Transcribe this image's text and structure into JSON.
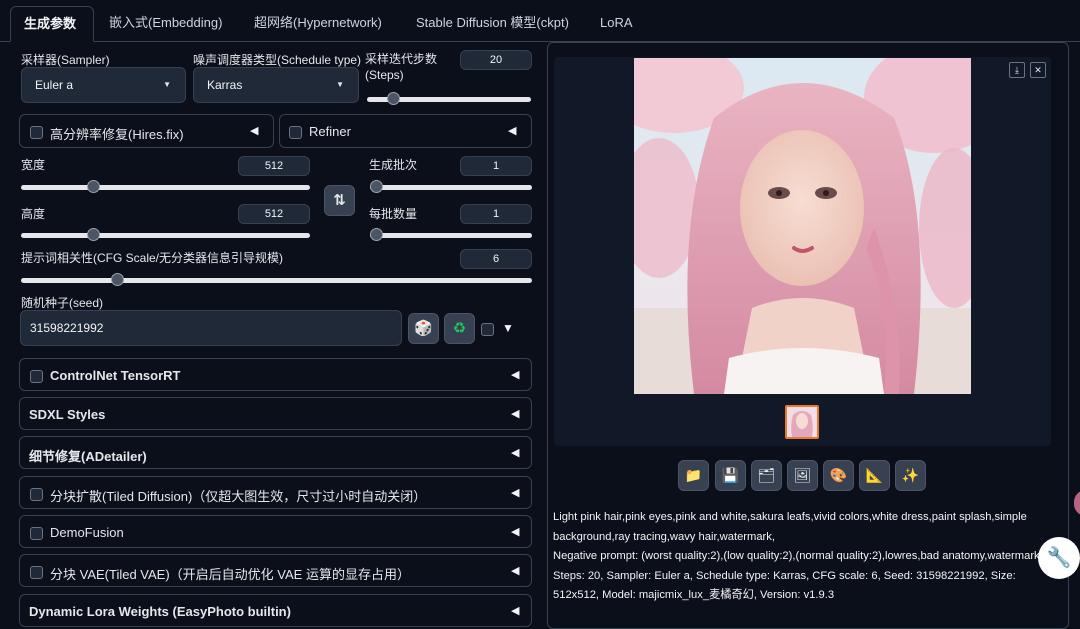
{
  "tabs": [
    "生成参数",
    "嵌入式(Embedding)",
    "超网络(Hypernetwork)",
    "Stable Diffusion 模型(ckpt)",
    "LoRA"
  ],
  "sampler": {
    "label": "采样器(Sampler)",
    "value": "Euler a"
  },
  "schedule": {
    "label": "噪声调度器类型(Schedule type)",
    "value": "Karras"
  },
  "steps": {
    "label_line1": "采样迭代步数",
    "label_line2": "(Steps)",
    "value": "20",
    "fraction": 0.13
  },
  "hires": {
    "label": "高分辨率修复(Hires.fix)",
    "collapse_glyph": "◀"
  },
  "refiner": {
    "label": "Refiner",
    "collapse_glyph": "◀"
  },
  "width": {
    "label": "宽度",
    "value": "512",
    "fraction": 0.24
  },
  "height": {
    "label": "高度",
    "value": "512",
    "fraction": 0.24
  },
  "swap_button": {
    "icon": "swap-icon",
    "glyph": "⇅"
  },
  "batch_count": {
    "label": "生成批次",
    "value": "1",
    "fraction": 0.0
  },
  "batch_size": {
    "label": "每批数量",
    "value": "1",
    "fraction": 0.0
  },
  "cfg": {
    "label": "提示词相关性(CFG Scale/无分类器信息引导规模)",
    "value": "6",
    "fraction": 0.18
  },
  "seed": {
    "label": "随机种子(seed)",
    "value": "31598221992",
    "dice_glyph": "🎲",
    "recycle_glyph": "♻",
    "extra_glyph": "▼"
  },
  "accordions": [
    {
      "label": "ControlNet TensorRT",
      "checkbox": true
    },
    {
      "label": "SDXL Styles",
      "checkbox": false
    },
    {
      "label": "细节修复(ADetailer)",
      "checkbox": false
    },
    {
      "label": "分块扩散(Tiled Diffusion)（仅超大图生效，尺寸过小时自动关闭）",
      "checkbox": true
    },
    {
      "label": "DemoFusion",
      "checkbox": true
    },
    {
      "label": "分块 VAE(Tiled VAE)（开启后自动优化 VAE 运算的显存占用）",
      "checkbox": true
    },
    {
      "label": "Dynamic Lora Weights (EasyPhoto builtin)",
      "checkbox": false
    }
  ],
  "accordion_glyph": "◀",
  "gallery": {
    "download_glyph": "⤓",
    "close_glyph": "✕"
  },
  "toolbar": [
    "folder-icon",
    "save-icon",
    "zip-icon",
    "image-icon",
    "palette-icon",
    "ruler-icon",
    "sparkle-icon"
  ],
  "toolbar_glyphs": [
    "📁",
    "💾",
    "🗂",
    "🖼",
    "🎨",
    "📐",
    "✨"
  ],
  "info": {
    "line1": "Light pink hair,pink eyes,pink and white,sakura leafs,vivid colors,white dress,paint splash,simple background,ray tracing,wavy hair,watermark,",
    "line2": "Negative prompt: (worst quality:2),(low quality:2),(normal quality:2),lowres,bad anatomy,watermark,",
    "line3": "Steps: 20, Sampler: Euler a, Schedule type: Karras, CFG scale: 6, Seed: 31598221992, Size: 512x512, Model: majicmix_lux_麦橘奇幻, Version: v1.9.3"
  },
  "colors": {
    "background": "#0b0f19",
    "panel": "#1f2937",
    "border": "#374151",
    "accent": "#e97a2b"
  }
}
